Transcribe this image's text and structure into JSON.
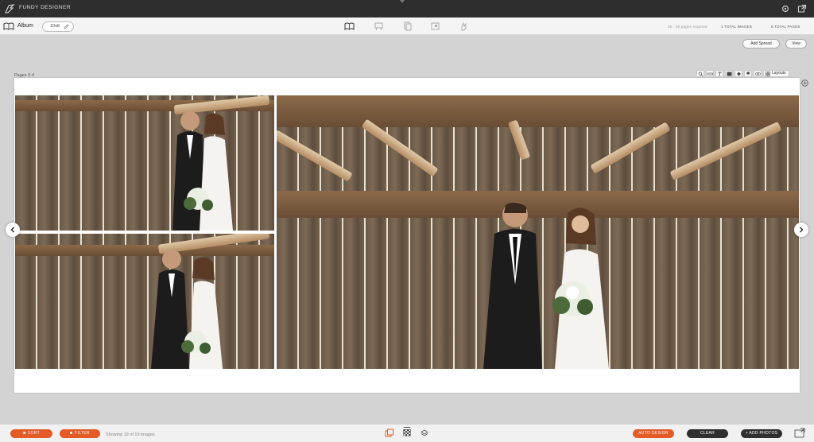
{
  "app": {
    "title": "FUNDY DESIGNER"
  },
  "toolbar": {
    "album_label": "Album",
    "size": "10x8",
    "pages_required": "20 - 50 pages required",
    "total_images": "1 TOTAL IMAGES",
    "total_pages": "6 TOTAL PAGES",
    "modes": [
      "album-mode-icon",
      "wall-art-icon",
      "cards-icon",
      "proofs-icon",
      "hands-icon"
    ]
  },
  "actions": {
    "add_spread": "Add Spread",
    "view": "View"
  },
  "canvas": {
    "pages_label": "Pages 3-4",
    "layouts_label": "Layouts",
    "tools": [
      "zoom-icon",
      "ruler-icon",
      "text-icon",
      "image-icon",
      "fill-icon",
      "flag-icon",
      "eye-icon"
    ]
  },
  "bottom": {
    "sort": "SORT",
    "filter": "FILTER",
    "showing": "Showing 19 of 19 images",
    "auto_design": "AUTO DESIGN",
    "clear": "CLEAR",
    "add_photos": "+ ADD PHOTOS"
  },
  "colors": {
    "accent": "#e35b27",
    "titlebar": "#2e2e2e",
    "canvas_bg": "#d3d3d3"
  }
}
